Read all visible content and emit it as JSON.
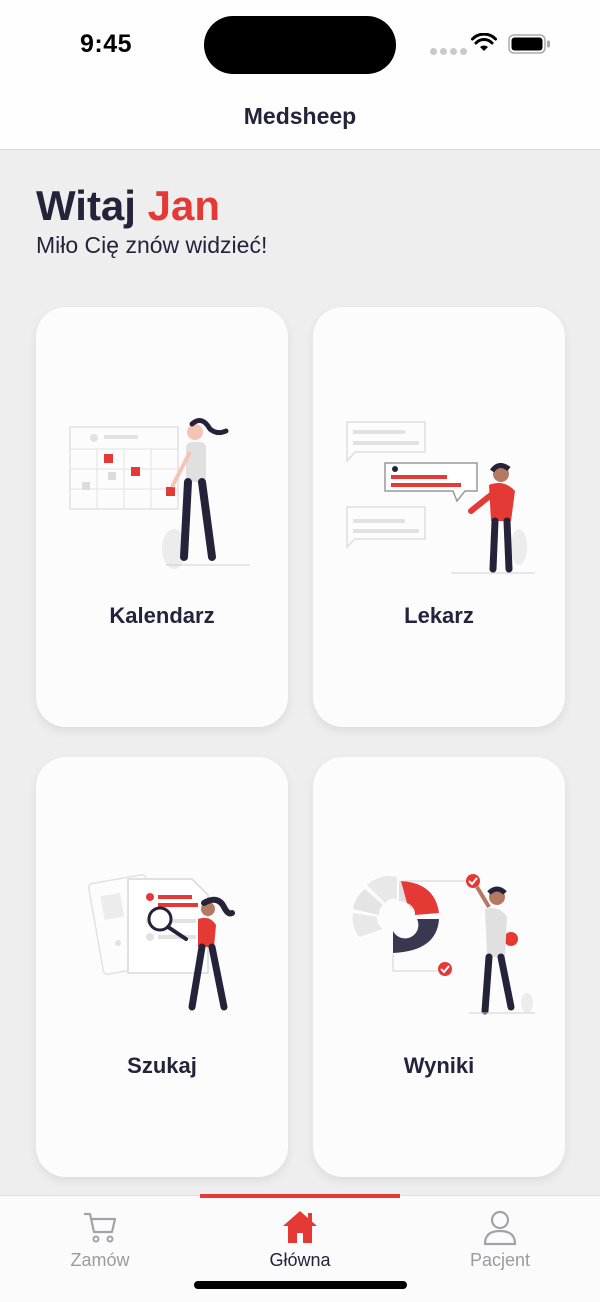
{
  "status_bar": {
    "time": "9:45"
  },
  "nav": {
    "title": "Medsheep"
  },
  "greeting": {
    "hello": "Witaj",
    "name": "Jan",
    "subtitle": "Miło Cię znów widzieć!"
  },
  "cards": [
    {
      "label": "Kalendarz",
      "icon": "calendar-illustration"
    },
    {
      "label": "Lekarz",
      "icon": "doctor-chat-illustration"
    },
    {
      "label": "Szukaj",
      "icon": "search-documents-illustration"
    },
    {
      "label": "Wyniki",
      "icon": "results-chart-illustration"
    }
  ],
  "tabs": [
    {
      "label": "Zamów",
      "icon": "cart-icon",
      "active": false
    },
    {
      "label": "Główna",
      "icon": "home-icon",
      "active": true
    },
    {
      "label": "Pacjent",
      "icon": "person-icon",
      "active": false
    }
  ],
  "colors": {
    "accent": "#e53935",
    "text": "#25233a",
    "background": "#efeeef",
    "card": "#fdfcfd"
  }
}
